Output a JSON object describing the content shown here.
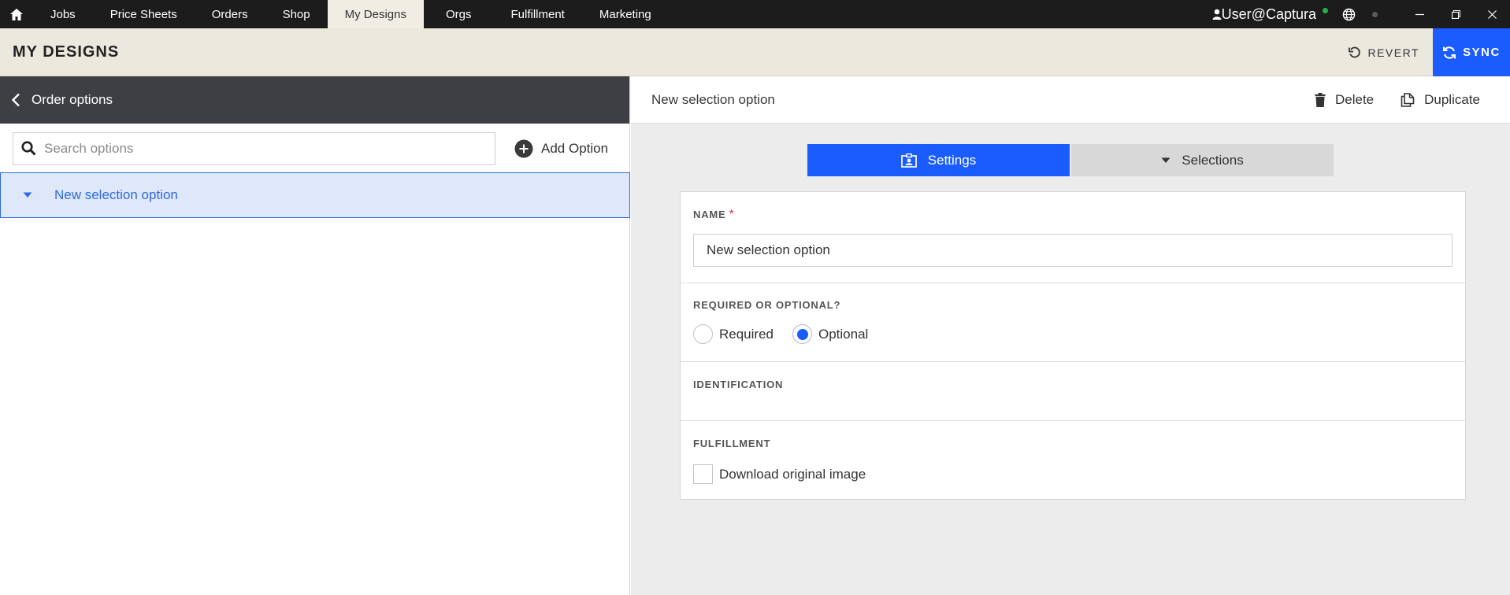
{
  "nav": {
    "home_icon": "home-icon",
    "items": [
      {
        "label": "Jobs"
      },
      {
        "label": "Price Sheets"
      },
      {
        "label": "Orders"
      },
      {
        "label": "Shop"
      },
      {
        "label": "My Designs",
        "active": true
      },
      {
        "label": "Orgs"
      },
      {
        "label": "Fulfillment"
      },
      {
        "label": "Marketing"
      }
    ],
    "user": "User@Captura",
    "status_color": "#21b24a"
  },
  "header": {
    "title": "MY DESIGNS",
    "revert_label": "REVERT",
    "sync_label": "SYNC",
    "accent": "#1a5cff"
  },
  "left": {
    "back_label": "Order options",
    "search_placeholder": "Search options",
    "add_label": "Add Option",
    "items": [
      {
        "label": "New selection option",
        "selected": true
      }
    ]
  },
  "right": {
    "title": "New selection option",
    "delete_label": "Delete",
    "duplicate_label": "Duplicate",
    "tabs": [
      {
        "label": "Settings",
        "active": true
      },
      {
        "label": "Selections",
        "active": false
      }
    ],
    "form": {
      "name_label": "NAME",
      "required_mark": "*",
      "name_value": "New selection option",
      "req_label": "REQUIRED OR OPTIONAL?",
      "required_label": "Required",
      "optional_label": "Optional",
      "selected_requirement": "Optional",
      "identification_label": "IDENTIFICATION",
      "fulfillment_label": "FULFILLMENT",
      "download_label": "Download original image",
      "download_checked": false
    }
  }
}
